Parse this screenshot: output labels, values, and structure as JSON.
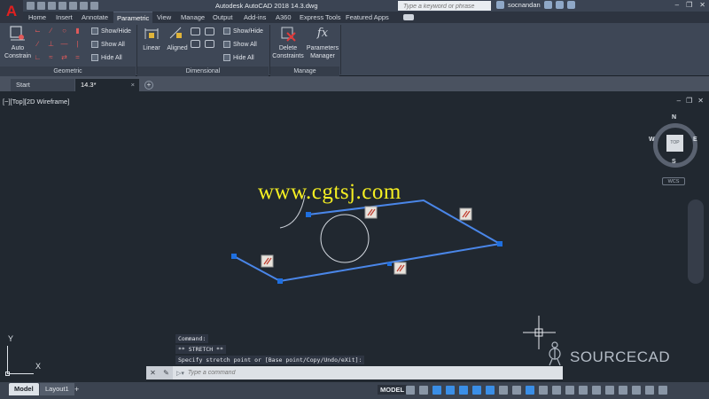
{
  "app": {
    "title": "Autodesk AutoCAD 2018    14.3.dwg",
    "logo_letter": "A"
  },
  "search": {
    "placeholder": "Type a keyword or phrase"
  },
  "user": {
    "name": "socnandan"
  },
  "ribbon_tabs": [
    "Home",
    "Insert",
    "Annotate",
    "Parametric",
    "View",
    "Manage",
    "Output",
    "Add-ins",
    "A360",
    "Express Tools",
    "Featured Apps"
  ],
  "active_ribbon_tab": "Parametric",
  "ribbon": {
    "geometric": {
      "auto_constrain": "Auto\nConstrain",
      "show_hide": "Show/Hide",
      "show_all": "Show All",
      "hide_all": "Hide All",
      "label": "Geometric"
    },
    "dimensional": {
      "linear": "Linear",
      "aligned": "Aligned",
      "show_hide": "Show/Hide",
      "show_all": "Show All",
      "hide_all": "Hide All",
      "label": "Dimensional"
    },
    "manage": {
      "delete_constraints": "Delete\nConstraints",
      "parameters_manager": "Parameters\nManager",
      "label": "Manage"
    }
  },
  "doc_tabs": [
    {
      "label": "Start"
    },
    {
      "label": "14.3*"
    }
  ],
  "viewport": {
    "label": "[−][Top][2D Wireframe]",
    "viewcube": {
      "face": "TOP",
      "n": "N",
      "s": "S",
      "e": "E",
      "w": "W",
      "wcs": "WCS"
    },
    "watermark": "www.cgtsj.com",
    "brand": "SOURCECAD",
    "ucs_x": "X",
    "ucs_y": "Y"
  },
  "command": {
    "history": [
      "Command:",
      "** STRETCH **",
      "Specify stretch point or [Base point/Copy/Undo/eXit]:"
    ],
    "placeholder": "Type a command"
  },
  "status": {
    "layout_tabs": [
      "Model",
      "Layout1"
    ],
    "model_button": "MODEL"
  },
  "colors": {
    "canvas": "#212830",
    "geometry": "#4a86e8",
    "grip": "#1e6fe0",
    "constraint_red": "#c0392b",
    "watermark": "#f5ef22"
  }
}
